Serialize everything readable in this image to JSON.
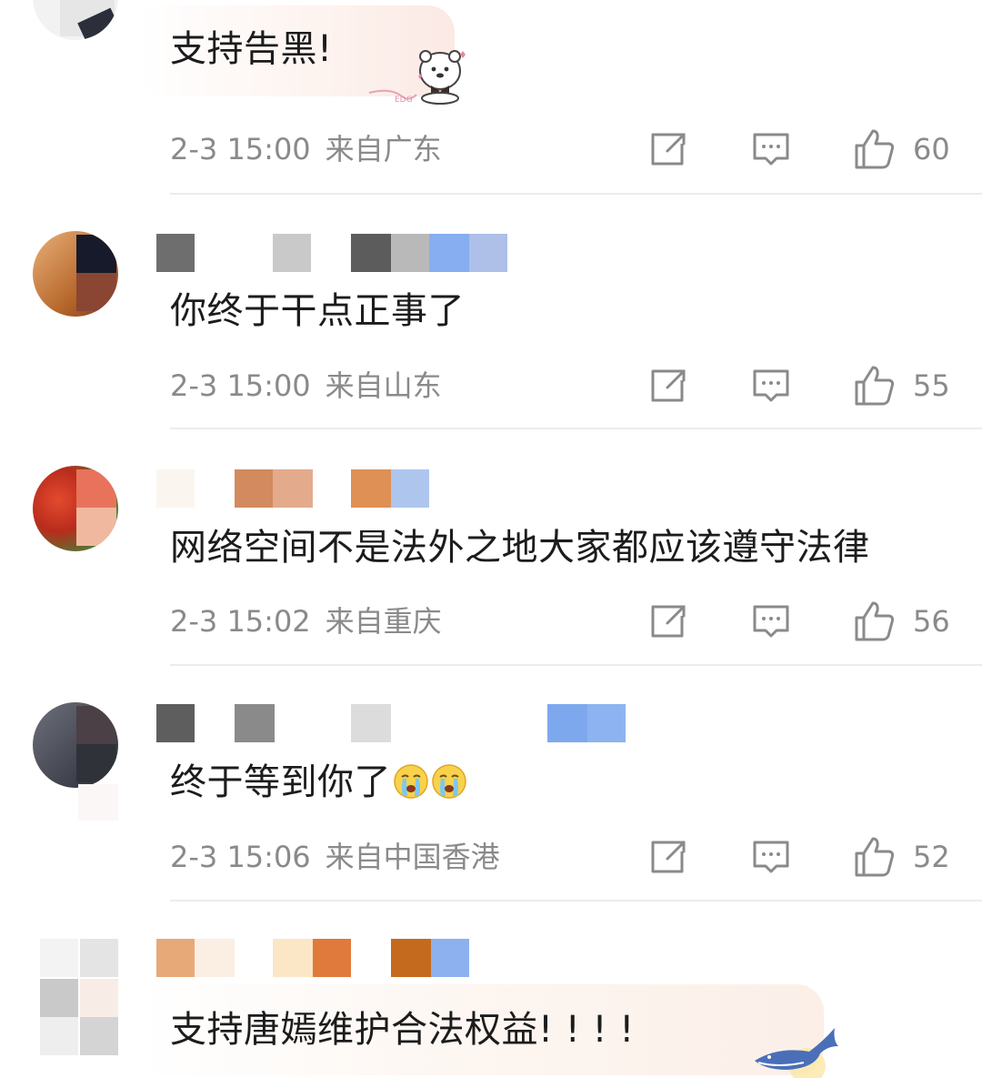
{
  "comments": [
    {
      "text": "支持告黑!",
      "time": "2-3 15:00",
      "location": "来自广东",
      "likes": "60"
    },
    {
      "text": "你终于干点正事了",
      "time": "2-3 15:00",
      "location": "来自山东",
      "likes": "55"
    },
    {
      "text": "网络空间不是法外之地大家都应该遵守法律",
      "time": "2-3 15:02",
      "location": "来自重庆",
      "likes": "56"
    },
    {
      "text": "终于等到你了",
      "time": "2-3 15:06",
      "location": "来自中国香港",
      "likes": "52"
    },
    {
      "text": "支持唐嫣维护合法权益! ! ! !"
    }
  ],
  "icons": {
    "share": "share-icon",
    "reply": "comment-icon",
    "like": "thumbs-up-icon",
    "crying": "crying-face-icon"
  },
  "colors": {
    "meta_text": "#8a8a8a",
    "divider": "#ececec",
    "body_text": "#1c1c1c"
  }
}
